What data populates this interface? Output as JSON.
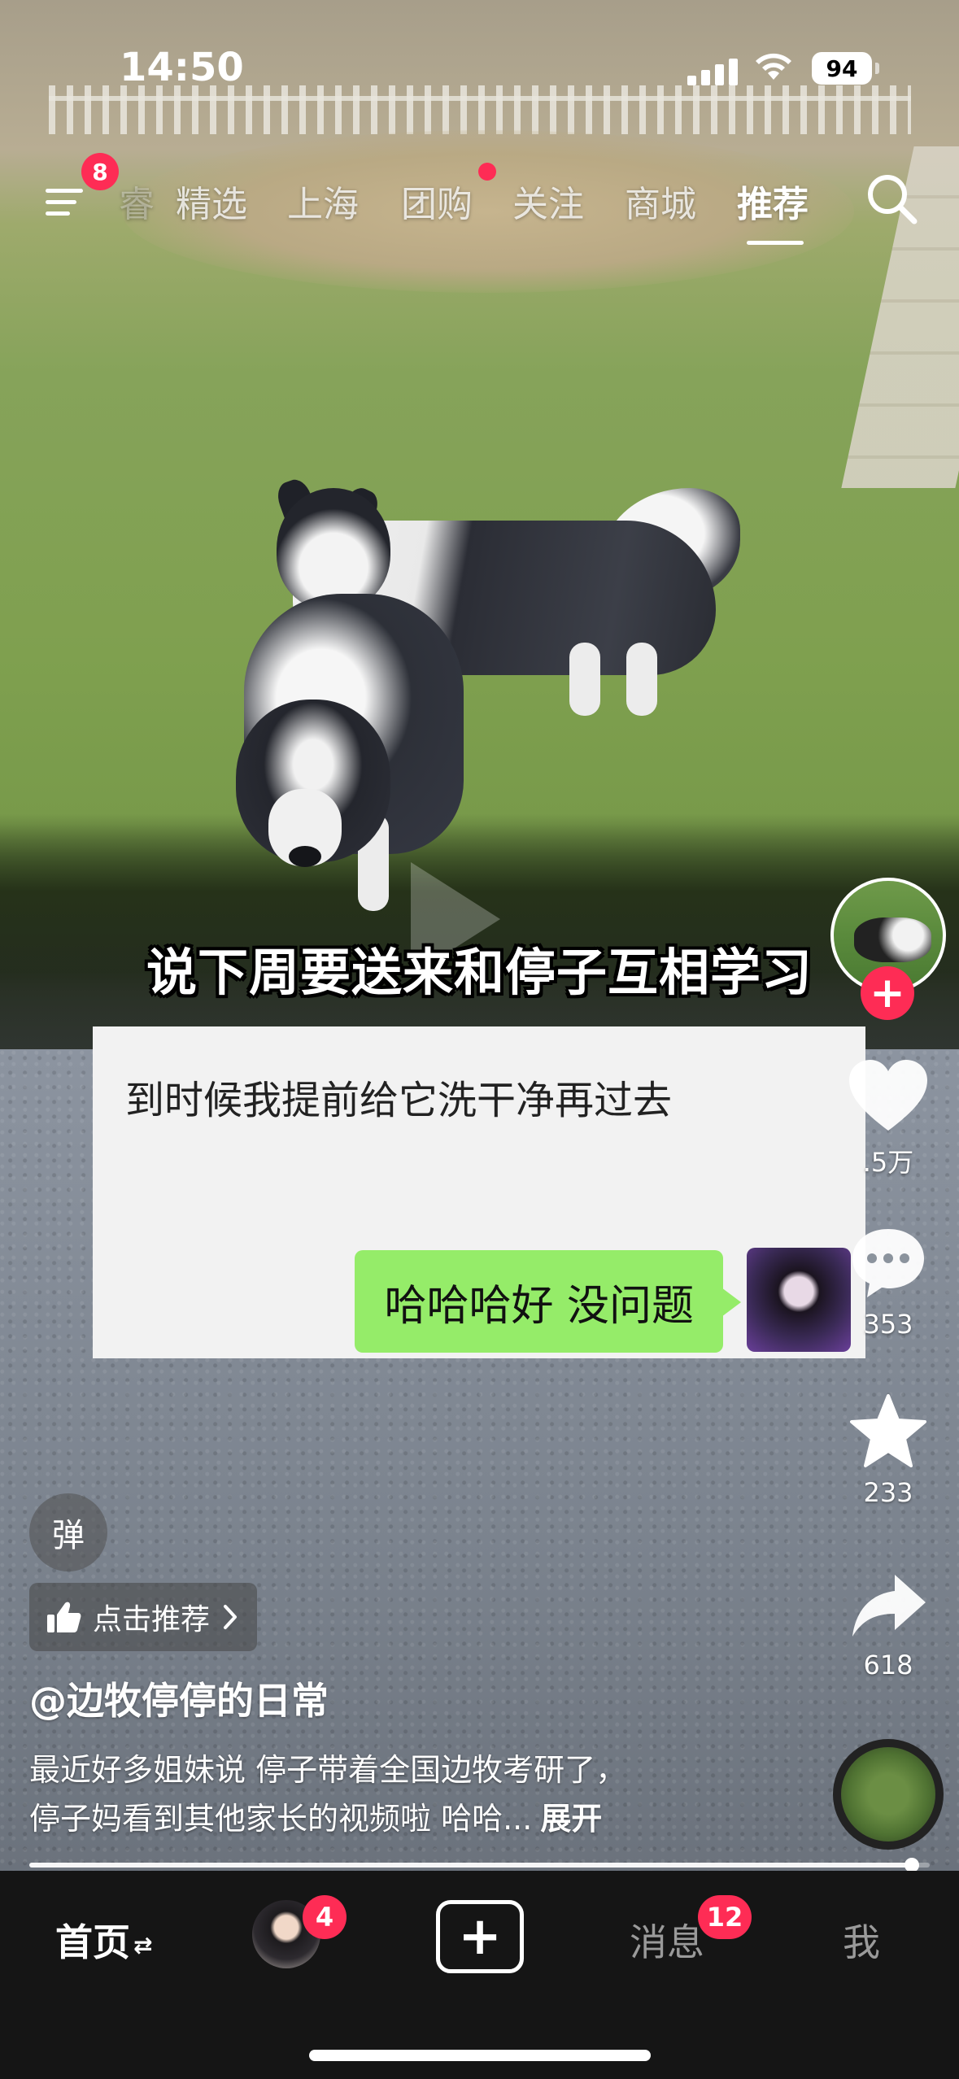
{
  "status_bar": {
    "time": "14:50",
    "battery": "94"
  },
  "top_nav": {
    "menu_badge": "8",
    "tabs": [
      {
        "label": "精选"
      },
      {
        "label": "上海"
      },
      {
        "label": "团购"
      },
      {
        "label": "关注"
      },
      {
        "label": "商城"
      },
      {
        "label": "推荐"
      }
    ],
    "active_tab": "推荐"
  },
  "video": {
    "caption": "说下周要送来和停子互相学习",
    "chat": {
      "received_text": "到时候我提前给它洗干净再过去",
      "sent_text": "哈哈哈好 没问题"
    }
  },
  "right_rail": {
    "like_count": ".5万",
    "comment_count": "353",
    "favorite_count": "233",
    "share_count": "618"
  },
  "bottom_overlay": {
    "danmu_label": "弹",
    "recommend_label": "点击推荐",
    "author": "@边牧停停的日常",
    "description_line1": "最近好多姐妹说 停子带着全国边牧考研了，",
    "description_line2": "停子妈看到其他家长的视频啦 哈哈...",
    "expand_label": "展开",
    "progress": 0.98
  },
  "bottom_nav": {
    "home_label": "首页",
    "friends_badge": "4",
    "messages_label": "消息",
    "messages_badge": "12",
    "me_label": "我"
  },
  "colors": {
    "badge_red": "#fe2c55",
    "chat_green": "#95ec69",
    "bottom_bar": "#151515"
  }
}
